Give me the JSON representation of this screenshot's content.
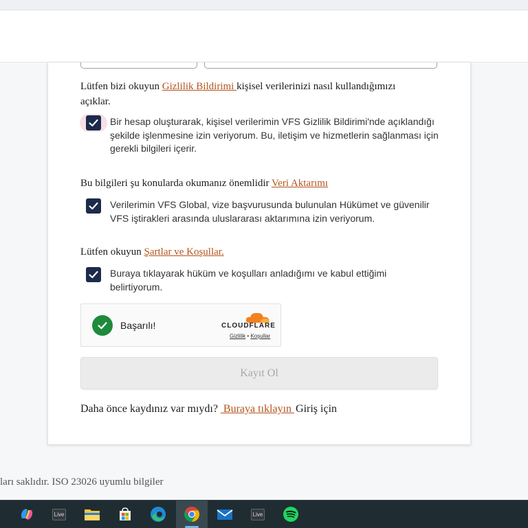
{
  "privacy": {
    "text_before": "Lütfen bizi okuyun ",
    "link": "Gizlilik Bildirimi ",
    "text_after": "kişisel verilerinizi nasıl kullandığımızı açıklar."
  },
  "consent_privacy": {
    "label": "Bir hesap oluşturarak, kişisel verilerimin VFS Gizlilik Bildirimi'nde açıklandığı şekilde işlenmesine izin veriyorum. Bu, iletişim ve hizmetlerin sağlanması için gerekli bilgileri içerir."
  },
  "transfer": {
    "text_before": "Bu bilgileri şu konularda okumanız önemlidir ",
    "link": "Veri Aktarımı"
  },
  "consent_transfer": {
    "label": "Verilerimin VFS Global, vize başvurusunda bulunulan Hükümet ve güvenilir VFS iştirakleri arasında uluslararası aktarımına izin veriyorum."
  },
  "terms": {
    "text_before": "Lütfen okuyun ",
    "link": "Şartlar ve Koşullar."
  },
  "consent_terms": {
    "label": "Buraya tıklayarak hüküm ve koşulları anladığımı ve kabul ettiğimi belirtiyorum."
  },
  "captcha": {
    "status": "Başarılı!",
    "brand": "CLOUDFLARE",
    "privacy_link": "Gizlilik",
    "separator": "•",
    "terms_link": "Koşullar"
  },
  "register_button": "Kayıt Ol",
  "login_prompt": {
    "text_before": "Daha önce kaydınız var mıydı?",
    "link": " Buraya tıklayın ",
    "text_after": "Giriş için"
  },
  "footer": {
    "text": "ları saklıdır. ISO 23026 uyumlu bilgiler"
  },
  "taskbar": {
    "live_label_1": "Live",
    "live_label_2": "Live"
  },
  "colors": {
    "link": "#b3541e",
    "checkbox": "#1b2b4b",
    "success": "#1e8a3c",
    "cloudflare_orange": "#f38020"
  }
}
